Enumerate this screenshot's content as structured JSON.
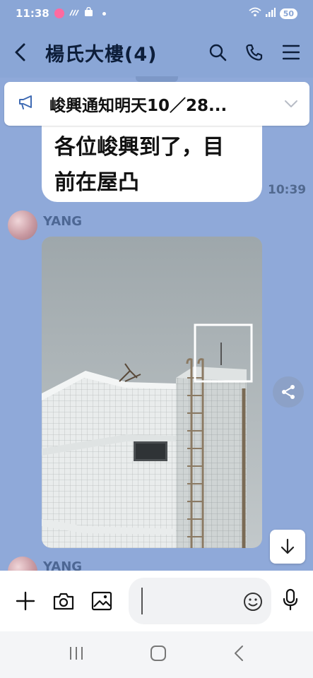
{
  "status": {
    "time": "11:38",
    "battery": "50"
  },
  "header": {
    "title": "楊氏大樓(4)"
  },
  "announcement": {
    "text": "峻興通知明天10／28..."
  },
  "messages": [
    {
      "text_line1": "各位峻興到了，目",
      "text_line2": "前在屋凸",
      "time": "10:39"
    }
  ],
  "photo_message": {
    "sender": "YANG"
  },
  "next_message": {
    "sender": "YANG"
  },
  "colors": {
    "chat_bg": "#8fa9d9",
    "header_bg": "#8aa6d6",
    "title": "#0d1e3a"
  }
}
